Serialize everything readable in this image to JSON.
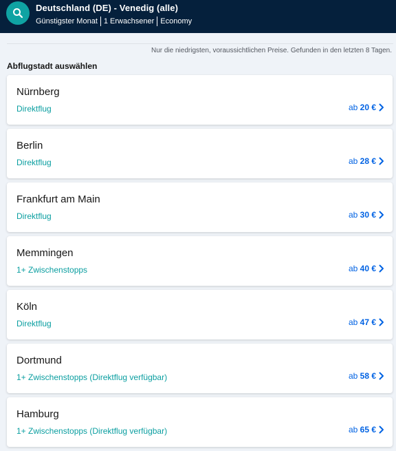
{
  "header": {
    "title": "Deutschland (DE) - Venedig (alle)",
    "filters": [
      "Günstigster Monat",
      "1 Erwachsener",
      "Economy"
    ]
  },
  "notice": "Nur die niedrigsten, voraussichtlichen Preise. Gefunden in den letzten 8 Tagen.",
  "section_title": "Abflugstadt auswählen",
  "price_prefix": "ab",
  "cities": [
    {
      "name": "Nürnberg",
      "route": "Direktflug",
      "price": "20 €"
    },
    {
      "name": "Berlin",
      "route": "Direktflug",
      "price": "28 €"
    },
    {
      "name": "Frankfurt am Main",
      "route": "Direktflug",
      "price": "30 €"
    },
    {
      "name": "Memmingen",
      "route": "1+ Zwischenstopps",
      "price": "40 €"
    },
    {
      "name": "Köln",
      "route": "Direktflug",
      "price": "47 €"
    },
    {
      "name": "Dortmund",
      "route": "1+ Zwischenstopps (Direktflug verfügbar)",
      "price": "58 €"
    },
    {
      "name": "Hamburg",
      "route": "1+ Zwischenstopps (Direktflug verfügbar)",
      "price": "65 €"
    }
  ],
  "colors": {
    "header_bg": "#05203c",
    "accent_teal": "#0fa3a3",
    "route_text": "#0a9ea0",
    "price_text": "#0062e3"
  },
  "icons": {
    "search": "search-icon",
    "chevron": "chevron-right-icon"
  }
}
